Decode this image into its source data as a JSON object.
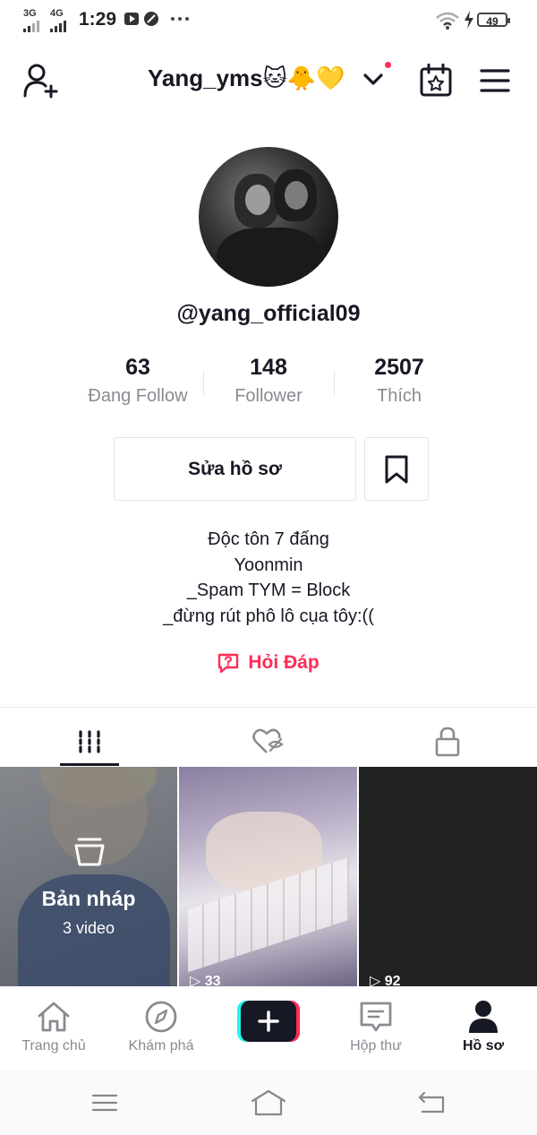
{
  "status_bar": {
    "network_1": "3G",
    "network_2": "4G",
    "time": "1:29",
    "battery": "49"
  },
  "header": {
    "title": "Yang_yms🐱🐥💛",
    "accent_color": "#fe2c55"
  },
  "profile": {
    "username": "@yang_official09",
    "stats": [
      {
        "value": "63",
        "label": "Đang Follow"
      },
      {
        "value": "148",
        "label": "Follower"
      },
      {
        "value": "2507",
        "label": "Thích"
      }
    ],
    "edit_label": "Sửa hồ sơ",
    "bio": [
      "Độc tôn 7 đấng",
      "Yoonmin",
      "_Spam TYM = Block",
      "_đừng rút phô lô cụa tôy:(("
    ],
    "qa_label": "Hỏi Đáp"
  },
  "tabs": [
    {
      "name": "videos",
      "icon": "grid-icon",
      "active": true
    },
    {
      "name": "liked",
      "icon": "heart-hidden-icon",
      "active": false
    },
    {
      "name": "private",
      "icon": "lock-icon",
      "active": false
    }
  ],
  "videos": {
    "draft_title": "Bản nháp",
    "draft_count": "3 video",
    "items": [
      {
        "plays": "▷ 33"
      },
      {
        "plays": "▷ 92"
      }
    ]
  },
  "bottom_nav": [
    {
      "label": "Trang chủ",
      "icon": "home-icon"
    },
    {
      "label": "Khám phá",
      "icon": "compass-icon"
    },
    {
      "label": "",
      "icon": "plus-icon"
    },
    {
      "label": "Hộp thư",
      "icon": "inbox-icon"
    },
    {
      "label": "Hồ sơ",
      "icon": "profile-icon"
    }
  ]
}
